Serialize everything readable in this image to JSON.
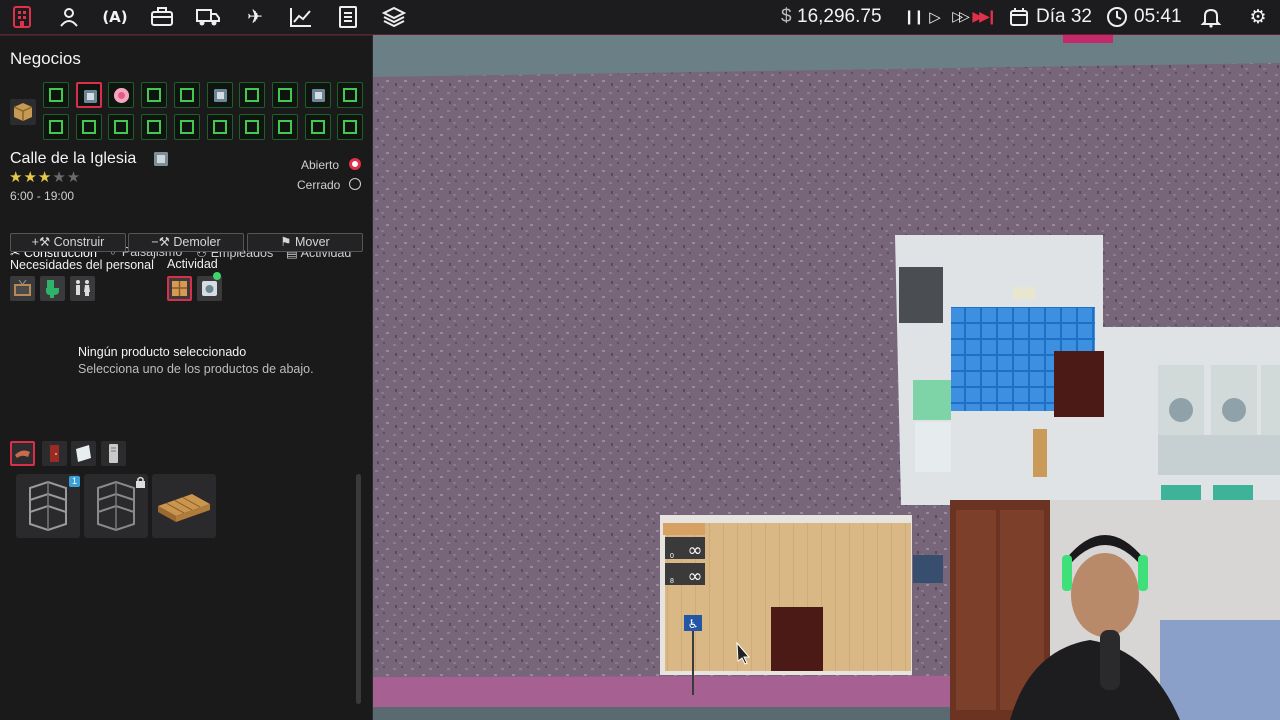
{
  "topbar": {
    "money_symbol": "$",
    "money": "16,296.75",
    "day": "Día 32",
    "time": "05:41",
    "nav_icons": [
      "business-icon",
      "hire-icon",
      "marketing-icon",
      "briefcase-icon",
      "vehicle-icon",
      "airplane-icon",
      "chart-icon",
      "document-icon",
      "layers-icon"
    ],
    "accent_color": "#e0304a"
  },
  "panel": {
    "title": "Negocios",
    "business": {
      "name": "Calle de la Iglesia",
      "rating": 3,
      "rating_max": 5,
      "hours": "6:00 - 19:00",
      "open_label": "Abierto",
      "closed_label": "Cerrado",
      "open": true
    },
    "tabs": [
      "Construcción",
      "Paisajismo",
      "Empleados",
      "Actividad"
    ],
    "buttons": {
      "build": "Construir",
      "demolish": "Demoler",
      "move": "Mover"
    },
    "staff_needs_label": "Necesidades del personal",
    "activity_label": "Actividad",
    "empty_title": "Ningún producto seleccionado",
    "empty_subtitle": "Selecciona uno de los productos de abajo.",
    "product_badge": "1"
  },
  "world": {
    "stock_counts": [
      "0",
      "8"
    ]
  }
}
